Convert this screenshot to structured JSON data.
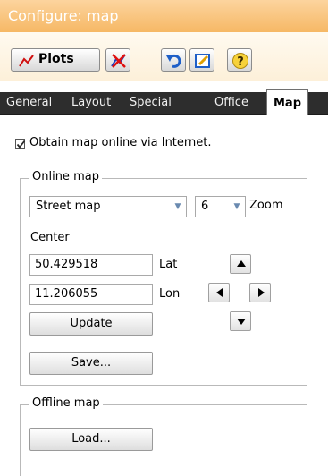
{
  "window": {
    "title": "Configure: map"
  },
  "toolbar": {
    "plots_label": "Plots",
    "icons": [
      "chart-line-icon",
      "remove-plot-icon",
      "undo-icon",
      "edit-icon",
      "help-icon"
    ]
  },
  "tabs": [
    {
      "label": "General",
      "active": false
    },
    {
      "label": "Layout",
      "active": false
    },
    {
      "label": "Special",
      "active": false
    },
    {
      "label": "Office",
      "active": false
    },
    {
      "label": "Map",
      "active": true
    }
  ],
  "online_checkbox": {
    "label": "Obtain map online via Internet.",
    "checked": true
  },
  "online_map": {
    "legend": "Online map",
    "map_type": "Street map",
    "zoom_value": "6",
    "zoom_label": "Zoom",
    "center_label": "Center",
    "lat_value": "50.429518",
    "lat_label": "Lat",
    "lon_value": "11.206055",
    "lon_label": "Lon",
    "update_label": "Update",
    "save_label": "Save..."
  },
  "offline_map": {
    "legend": "Offline map",
    "load_label": "Load..."
  },
  "colors": {
    "title_bar": "#f6b865",
    "tab_strip": "#2d2d2d",
    "combo_arrow": "#6a8ab0"
  }
}
